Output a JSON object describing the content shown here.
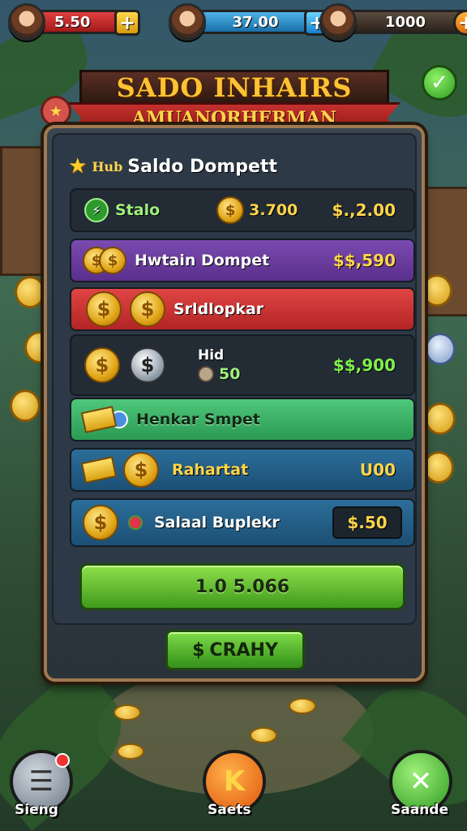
{
  "hud": {
    "player1_value": "5.50",
    "player2_value": "37.00",
    "player3_value": "1000",
    "plus_symbol": "+"
  },
  "banner": {
    "title": "SADO INHAIRS",
    "subtitle": "AMUANORHERMAN"
  },
  "panel": {
    "tag": "Hub",
    "title": "Saldo Dompett",
    "rows": [
      {
        "label": "Stalo",
        "mid": "3.700",
        "value": "$.,2.00"
      },
      {
        "label": "Hwtain Dompet",
        "value": "$$,590"
      },
      {
        "label": "Srldlopkar"
      },
      {
        "label": "Hid",
        "mid": "50",
        "value": "$$,900"
      },
      {
        "label": "Henkar Smpet"
      },
      {
        "label": "Rahartat",
        "value": "U00"
      },
      {
        "label": "Salaal Buplekr",
        "value": "$.50"
      }
    ],
    "main_button": "1.0 5.066",
    "crazy_button": "CRAHY",
    "crazy_symbol": "$"
  },
  "nav": {
    "left_label": "Sieng",
    "center_label": "Saets",
    "right_label": "Saande"
  },
  "colors": {
    "accent_gold": "#ffd54a",
    "accent_green": "#7ff04a",
    "panel_bg": "#2d3946"
  }
}
